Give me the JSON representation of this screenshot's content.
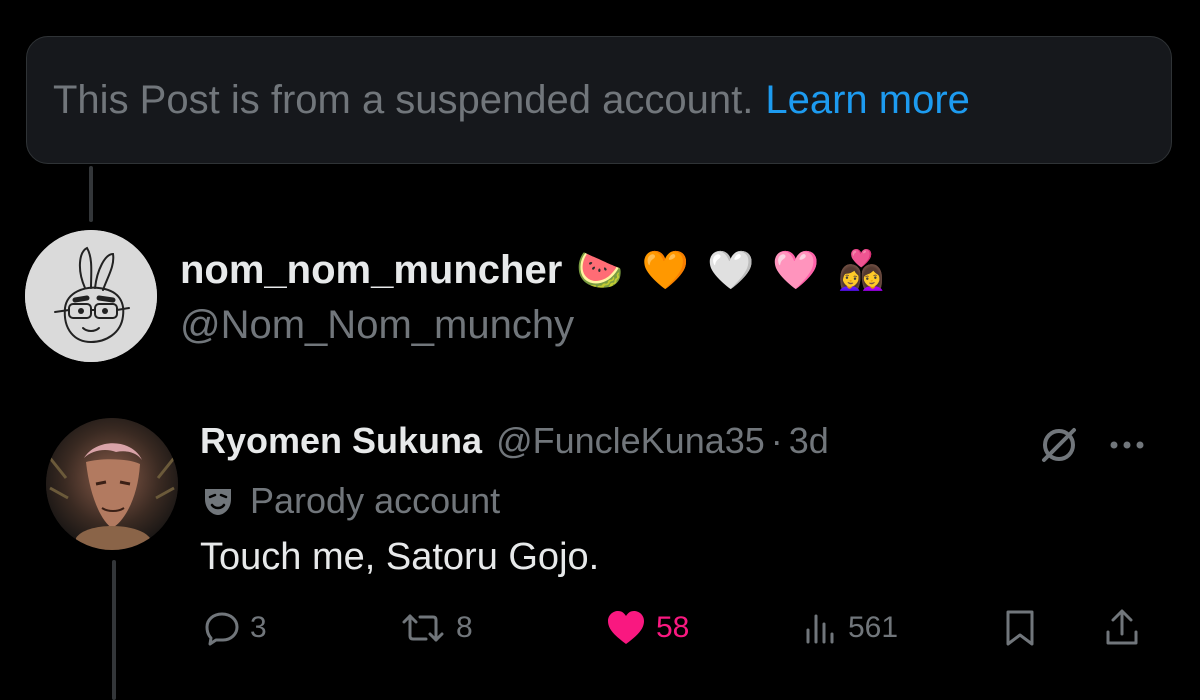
{
  "notice": {
    "text": "This Post is from a suspended account.",
    "link": "Learn more"
  },
  "parent_user": {
    "display_name": "nom_nom_muncher",
    "emojis": [
      "🍉",
      "🧡",
      "🤍",
      "🩷",
      "👩‍❤️‍👩"
    ],
    "handle": "@Nom_Nom_munchy"
  },
  "reply": {
    "display_name": "Ryomen Sukuna",
    "handle": "@FuncleKuna35",
    "separator": "·",
    "time": "3d",
    "label": "Parody account",
    "text": "Touch me, Satoru Gojo.",
    "actions": {
      "replies": "3",
      "reposts": "8",
      "likes": "58",
      "views": "561"
    }
  },
  "icons": {
    "parody": "theater-mask-icon",
    "grok": "grok-icon",
    "more": "more-dots-icon",
    "reply": "comment-icon",
    "repost": "repost-icon",
    "like": "heart-icon",
    "views": "views-chart-icon",
    "bookmark": "bookmark-icon",
    "share": "share-icon"
  },
  "colors": {
    "background": "#000000",
    "text_primary": "#e7e9ea",
    "text_secondary": "#71767b",
    "link": "#1d9bf0",
    "like": "#f91880"
  }
}
